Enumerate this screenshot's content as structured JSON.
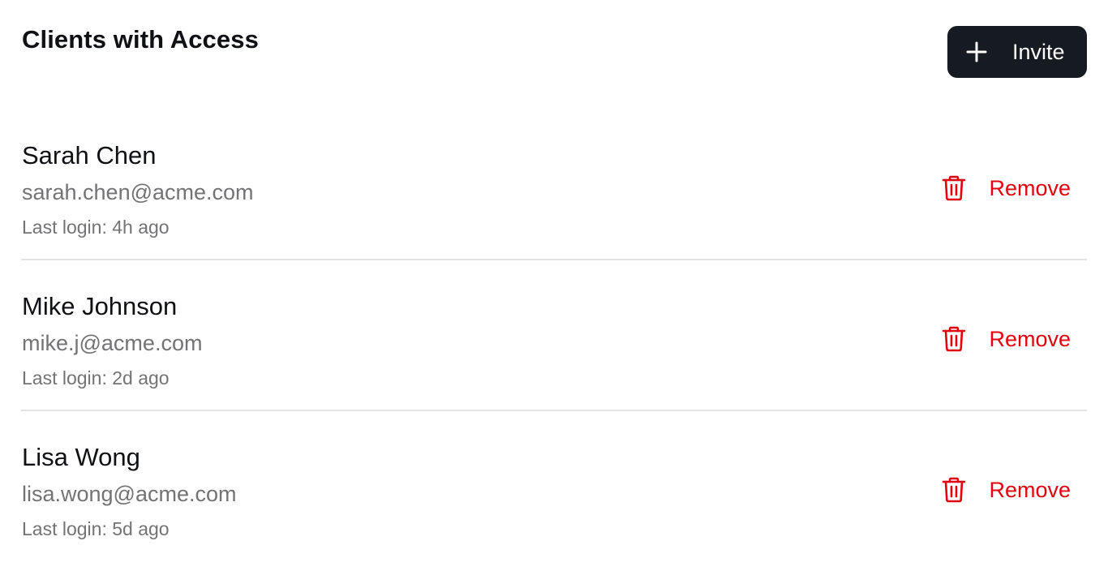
{
  "header": {
    "title": "Clients with Access",
    "invite_label": "Invite",
    "invite_icon": "plus-icon"
  },
  "colors": {
    "primary_button": "#161a21",
    "danger": "#e0040e",
    "muted_text": "#737376",
    "divider": "#e3e3e5"
  },
  "clients": [
    {
      "name": "Sarah Chen",
      "email": "sarah.chen@acme.com",
      "last_login": "Last login: 4h ago",
      "remove_label": "Remove",
      "remove_icon": "trash-icon"
    },
    {
      "name": "Mike Johnson",
      "email": "mike.j@acme.com",
      "last_login": "Last login: 2d ago",
      "remove_label": "Remove",
      "remove_icon": "trash-icon"
    },
    {
      "name": "Lisa Wong",
      "email": "lisa.wong@acme.com",
      "last_login": "Last login: 5d ago",
      "remove_label": "Remove",
      "remove_icon": "trash-icon"
    }
  ]
}
